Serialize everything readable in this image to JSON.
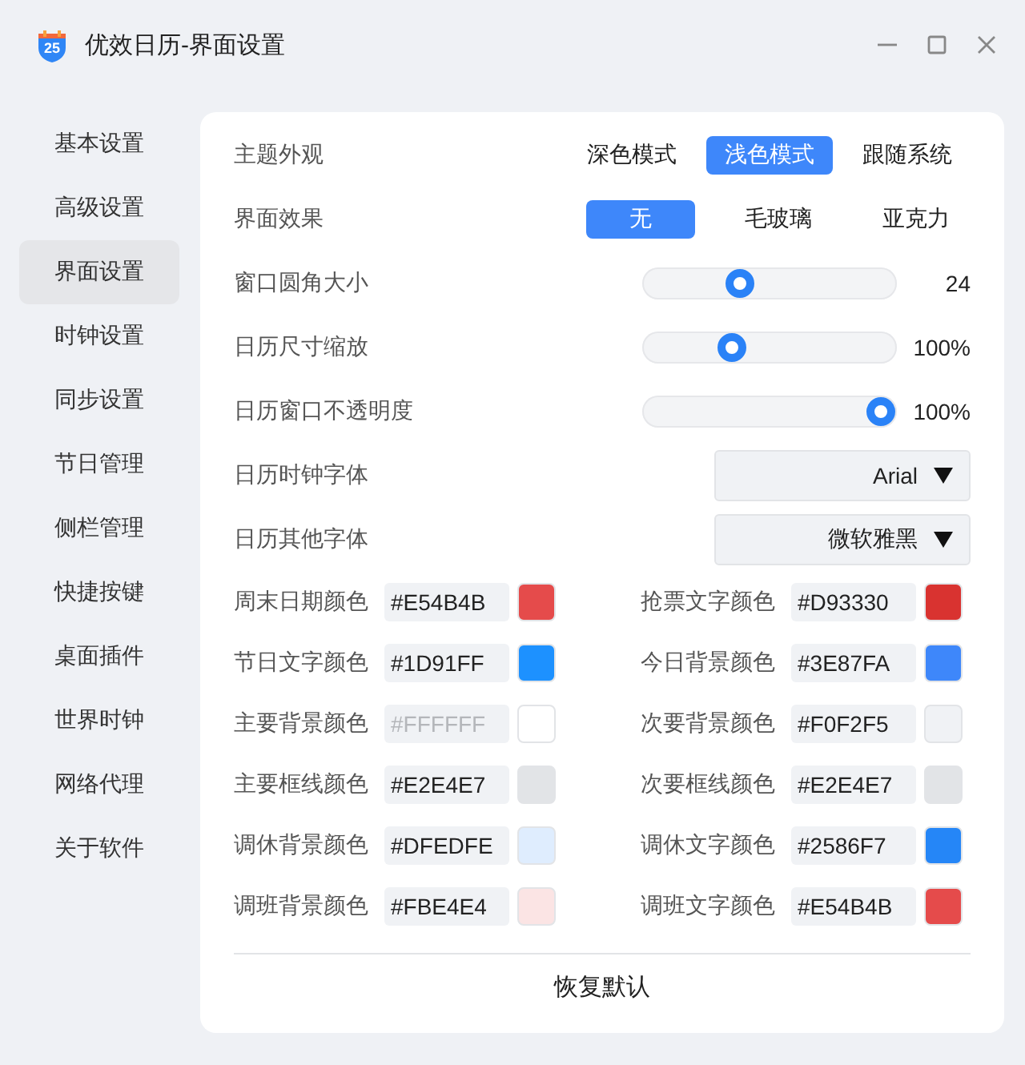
{
  "window": {
    "title": "优效日历-界面设置",
    "icon_label": "25"
  },
  "sidebar": {
    "items": [
      {
        "label": "基本设置",
        "selected": false
      },
      {
        "label": "高级设置",
        "selected": false
      },
      {
        "label": "界面设置",
        "selected": true
      },
      {
        "label": "时钟设置",
        "selected": false
      },
      {
        "label": "同步设置",
        "selected": false
      },
      {
        "label": "节日管理",
        "selected": false
      },
      {
        "label": "侧栏管理",
        "selected": false
      },
      {
        "label": "快捷按键",
        "selected": false
      },
      {
        "label": "桌面插件",
        "selected": false
      },
      {
        "label": "世界时钟",
        "selected": false
      },
      {
        "label": "网络代理",
        "selected": false
      },
      {
        "label": "关于软件",
        "selected": false
      }
    ]
  },
  "segments": [
    {
      "label": "主题外观",
      "options": [
        {
          "label": "深色模式",
          "selected": false
        },
        {
          "label": "浅色模式",
          "selected": true
        },
        {
          "label": "跟随系统",
          "selected": false
        }
      ]
    },
    {
      "label": "界面效果",
      "options": [
        {
          "label": "无",
          "selected": true
        },
        {
          "label": "毛玻璃",
          "selected": false
        },
        {
          "label": "亚克力",
          "selected": false
        }
      ]
    }
  ],
  "sliders": [
    {
      "label": "窗口圆角大小",
      "level": 0.37,
      "reading": "24"
    },
    {
      "label": "日历尺寸缩放",
      "level": 0.33,
      "reading": "100%"
    },
    {
      "label": "日历窗口不透明度",
      "level": 1,
      "reading": "100%"
    }
  ],
  "fonts": [
    {
      "label": "日历时钟字体",
      "value": "Arial"
    },
    {
      "label": "日历其他字体",
      "value": "微软雅黑"
    }
  ],
  "colors": [
    {
      "label": "周末日期颜色",
      "value": "#E54B4B",
      "color": "#e54b4b"
    },
    {
      "label": "抢票文字颜色",
      "value": "#D93330",
      "color": "#d93330"
    },
    {
      "label": "节日文字颜色",
      "value": "#1D91FF",
      "color": "#1d91ff"
    },
    {
      "label": "今日背景颜色",
      "value": "#3E87FA",
      "color": "#3e87fa"
    },
    {
      "label": "主要背景颜色",
      "placeholder": "#FFFFFF",
      "color": "#ffffff"
    },
    {
      "label": "次要背景颜色",
      "value": "#F0F2F5",
      "color": "#f0f2f5"
    },
    {
      "label": "主要框线颜色",
      "value": "#E2E4E7",
      "color": "#e2e4e7"
    },
    {
      "label": "次要框线颜色",
      "value": "#E2E4E7",
      "color": "#e2e4e7"
    },
    {
      "label": "调休背景颜色",
      "value": "#DFEDFE",
      "color": "#dfedfe"
    },
    {
      "label": "调休文字颜色",
      "value": "#2586F7",
      "color": "#2586f7"
    },
    {
      "label": "调班背景颜色",
      "value": "#FBE4E4",
      "color": "#fbe4e4"
    },
    {
      "label": "调班文字颜色",
      "value": "#E54B4B",
      "color": "#e54b4b"
    }
  ],
  "reset_button": {
    "label": "恢复默认"
  }
}
